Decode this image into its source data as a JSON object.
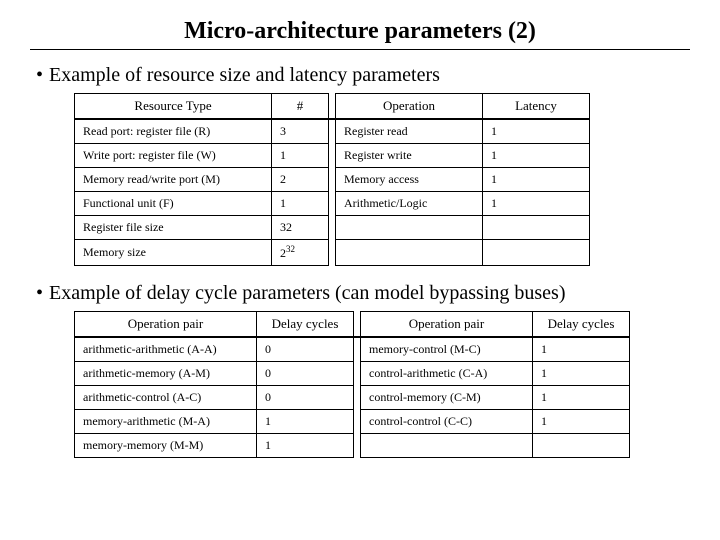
{
  "title": "Micro-architecture parameters (2)",
  "bullets": {
    "b1": "Example of resource size and latency parameters",
    "b2": "Example of delay cycle parameters (can model bypassing buses)"
  },
  "table1": {
    "headers": {
      "h1": "Resource Type",
      "h2": "#",
      "h3": "Operation",
      "h4": "Latency"
    },
    "rows": {
      "r0c0": "Read port: register file (R)",
      "r0c1": "3",
      "r0c2": "Register read",
      "r0c3": "1",
      "r1c0": "Write port: register file (W)",
      "r1c1": "1",
      "r1c2": "Register write",
      "r1c3": "1",
      "r2c0": "Memory read/write port (M)",
      "r2c1": "2",
      "r2c2": "Memory access",
      "r2c3": "1",
      "r3c0": "Functional unit (F)",
      "r3c1": "1",
      "r3c2": "Arithmetic/Logic",
      "r3c3": "1",
      "r4c0": "Register file size",
      "r4c1": "32",
      "r4c2": "",
      "r4c3": "",
      "r5c0": "Memory size",
      "r5c1_html": "2<sup>32</sup>",
      "r5c2": "",
      "r5c3": ""
    }
  },
  "table2": {
    "headers": {
      "h1": "Operation pair",
      "h2": "Delay cycles",
      "h3": "Operation pair",
      "h4": "Delay cycles"
    },
    "rows": {
      "r0c0": "arithmetic-arithmetic (A-A)",
      "r0c1": "0",
      "r0c2": "memory-control (M-C)",
      "r0c3": "1",
      "r1c0": "arithmetic-memory (A-M)",
      "r1c1": "0",
      "r1c2": "control-arithmetic (C-A)",
      "r1c3": "1",
      "r2c0": "arithmetic-control (A-C)",
      "r2c1": "0",
      "r2c2": "control-memory (C-M)",
      "r2c3": "1",
      "r3c0": "memory-arithmetic (M-A)",
      "r3c1": "1",
      "r3c2": "control-control (C-C)",
      "r3c3": "1",
      "r4c0": "memory-memory (M-M)",
      "r4c1": "1",
      "r4c2": "",
      "r4c3": ""
    }
  }
}
